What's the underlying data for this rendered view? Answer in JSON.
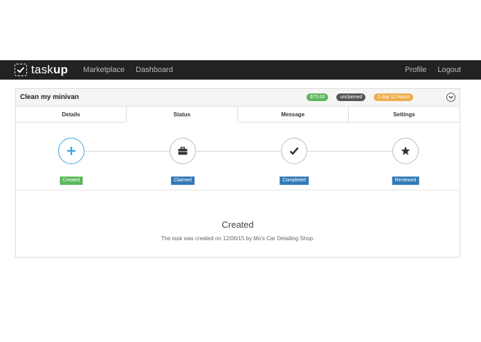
{
  "navbar": {
    "brand_regular": "task",
    "brand_bold": "up",
    "left_links": [
      "Marketplace",
      "Dashboard"
    ],
    "right_links": [
      "Profile",
      "Logout"
    ]
  },
  "task": {
    "title": "Clean my minivan",
    "price_badge": "$75.00",
    "status_badge": "unclaimed",
    "time_badge": "1 day 12 hours"
  },
  "tabs": [
    "Details",
    "Status",
    "Message",
    "Settings"
  ],
  "active_tab": "Status",
  "steps": [
    {
      "label": "Created",
      "icon": "plus-icon",
      "active": true
    },
    {
      "label": "Claimed",
      "icon": "briefcase-icon",
      "active": false
    },
    {
      "label": "Completed",
      "icon": "checkmark-icon",
      "active": false
    },
    {
      "label": "Reviewed",
      "icon": "star-icon",
      "active": false
    }
  ],
  "status_detail": {
    "title": "Created",
    "description": "The task was created on 12/06/15 by Mo's Car Detailing Shop."
  },
  "colors": {
    "navbar": "#222222",
    "accent": "#3ca3dc",
    "green": "#5cb85c",
    "blue": "#337ab7",
    "orange": "#f0ad4e",
    "dark_badge": "#555555"
  }
}
